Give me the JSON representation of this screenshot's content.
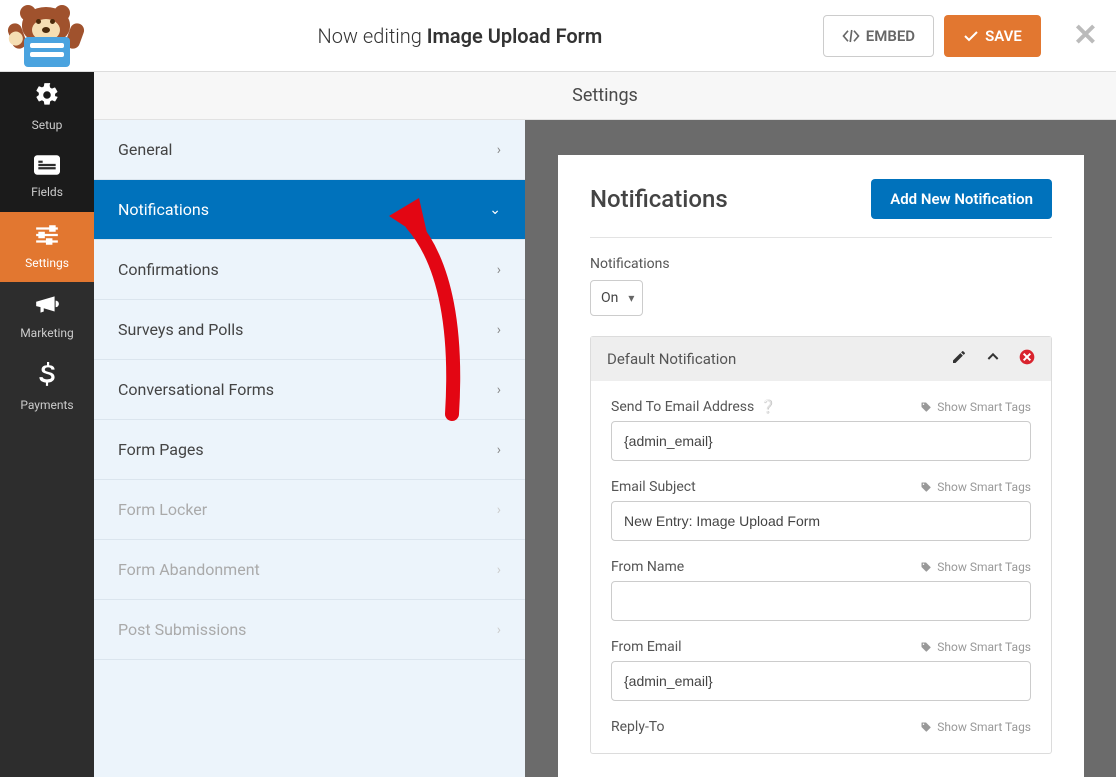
{
  "header": {
    "title_prefix": "Now editing ",
    "title_strong": "Image Upload Form",
    "embed_label": "EMBED",
    "save_label": "SAVE",
    "close_glyph": "✕"
  },
  "sidebar": {
    "items": [
      {
        "label": "Setup"
      },
      {
        "label": "Fields"
      },
      {
        "label": "Settings"
      },
      {
        "label": "Marketing"
      },
      {
        "label": "Payments"
      }
    ]
  },
  "settings_title": "Settings",
  "settings_list": {
    "items": [
      {
        "label": "General"
      },
      {
        "label": "Notifications"
      },
      {
        "label": "Confirmations"
      },
      {
        "label": "Surveys and Polls"
      },
      {
        "label": "Conversational Forms"
      },
      {
        "label": "Form Pages"
      },
      {
        "label": "Form Locker"
      },
      {
        "label": "Form Abandonment"
      },
      {
        "label": "Post Submissions"
      }
    ]
  },
  "panel": {
    "heading": "Notifications",
    "add_button": "Add New Notification",
    "toggle_label": "Notifications",
    "toggle_value": "On",
    "notif_title": "Default Notification",
    "smart_tags_label": "Show Smart Tags",
    "fields": {
      "send_to": {
        "label": "Send To Email Address",
        "value": "{admin_email}"
      },
      "subject": {
        "label": "Email Subject",
        "value": "New Entry: Image Upload Form"
      },
      "from_name": {
        "label": "From Name",
        "value": ""
      },
      "from_email": {
        "label": "From Email",
        "value": "{admin_email}"
      },
      "reply_to": {
        "label": "Reply-To"
      }
    }
  }
}
